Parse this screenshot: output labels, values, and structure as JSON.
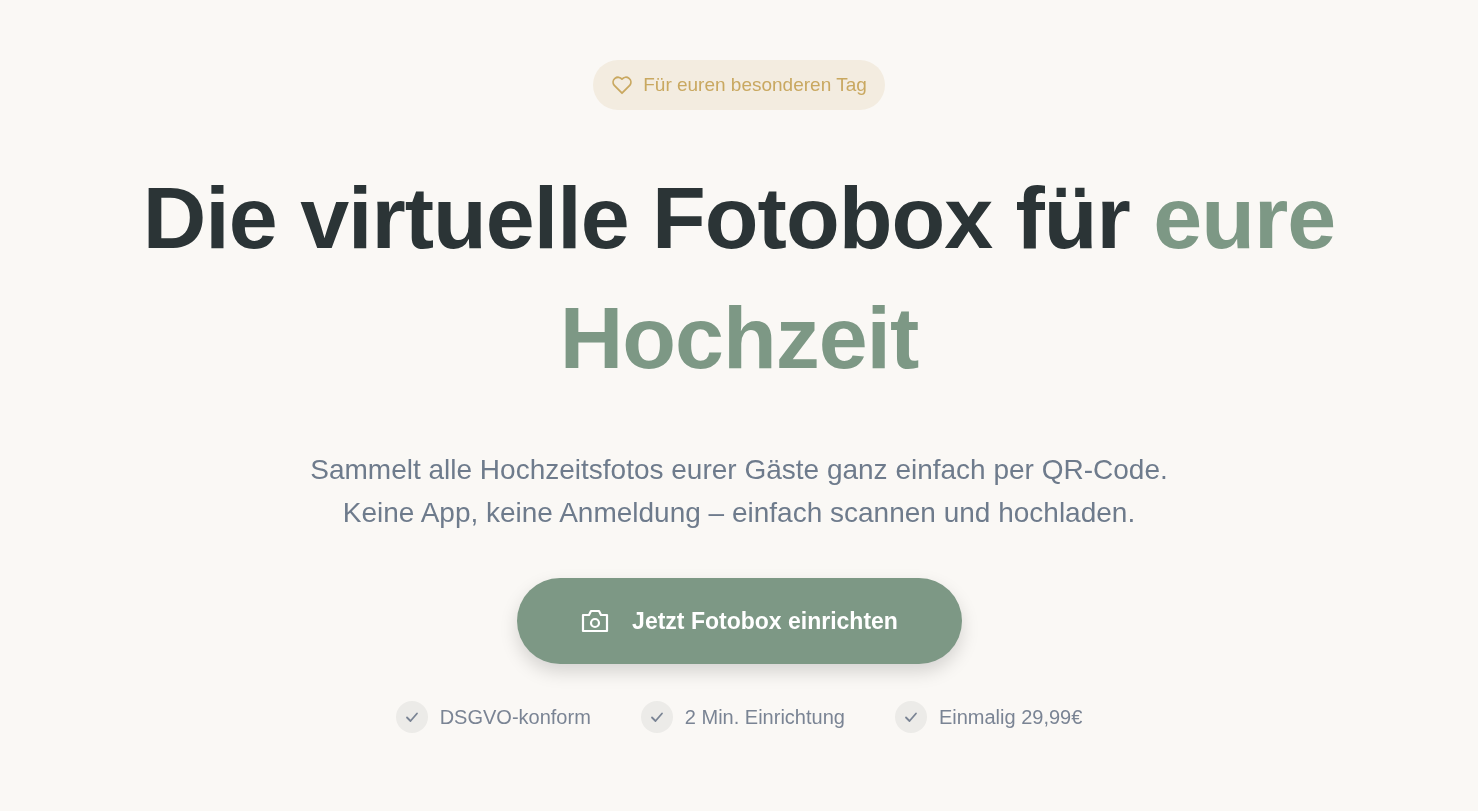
{
  "badge": {
    "text": "Für euren besonderen Tag"
  },
  "headline": {
    "lead": "Die virtuelle Fotobox für ",
    "highlight": "eure Hochzeit"
  },
  "subtitle": [
    "Sammelt alle Hochzeitsfotos eurer Gäste ganz einfach per QR-Code.",
    "Keine App, keine Anmeldung – einfach scannen und hochladen."
  ],
  "cta_button": {
    "label": "Jetzt Fotobox einrichten"
  },
  "features": [
    {
      "text": "DSGVO-konform"
    },
    {
      "text": "2 Min. Einrichtung"
    },
    {
      "text": "Einmalig 29,99€"
    }
  ]
}
